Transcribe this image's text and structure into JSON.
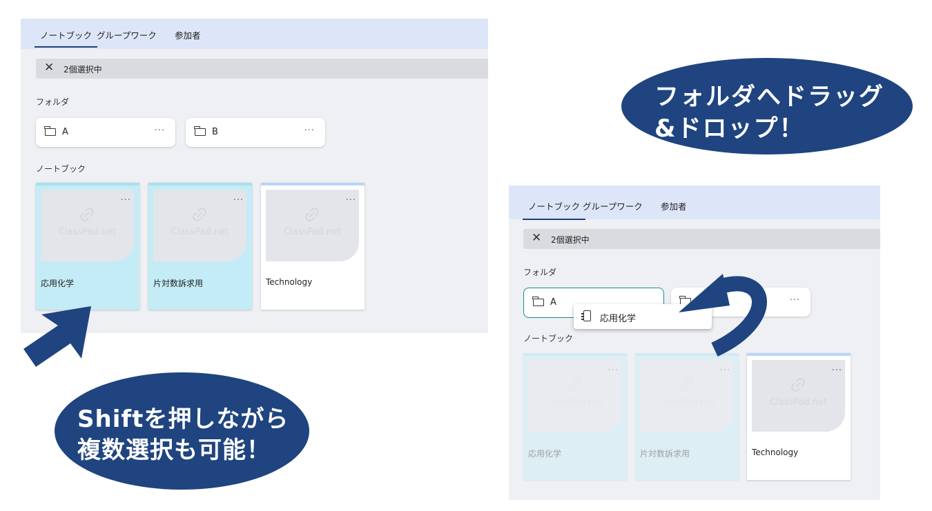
{
  "tabs": [
    "ノートブック",
    "グループワーク",
    "参加者"
  ],
  "selection_bar": {
    "close_symbol": "✕",
    "count_text": "2個選択中"
  },
  "sections": {
    "folders": "フォルダ",
    "notebooks": "ノートブック"
  },
  "folders": [
    {
      "name": "A",
      "menu": "···"
    },
    {
      "name": "B",
      "menu": "···"
    }
  ],
  "menu_glyph": "···",
  "thumbnail_logo": "ClassPad.net",
  "notebooks": [
    {
      "title": "応用化学",
      "selected": true
    },
    {
      "title": "片対数訴求用",
      "selected": true
    },
    {
      "title": "Technology",
      "selected": false
    }
  ],
  "drag_ghost": {
    "title": "応用化学"
  },
  "callouts": {
    "drag_drop": {
      "line1": "フォルダへドラッグ",
      "line2": "&ドロップ！"
    },
    "multi_select": {
      "line1": "Shiftを押しながら",
      "line2": "複数選択も可能！"
    }
  },
  "colors": {
    "callout_fill": "#1f4480",
    "tab_bar": "#dde6f8",
    "selected_card": "#c3ecf6",
    "panel_bg": "#eef0f4",
    "hover_folder_border": "#1a8a94"
  }
}
